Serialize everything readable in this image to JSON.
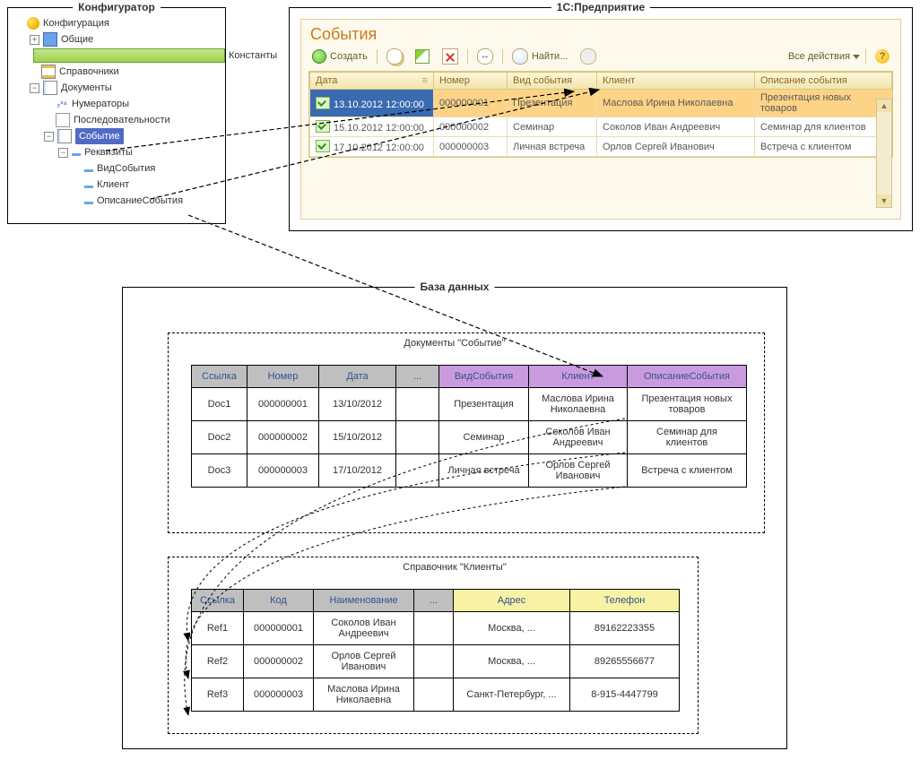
{
  "configurator": {
    "title": "Конфигуратор",
    "root": "Конфигурация",
    "items": {
      "common": "Общие",
      "constants": "Константы",
      "catalogs": "Справочники",
      "documents": "Документы",
      "numerators": "Нумераторы",
      "sequences": "Последовательности",
      "event": "Событие",
      "requisites": "Реквизиты",
      "req_kind": "ВидСобытия",
      "req_client": "Клиент",
      "req_desc": "ОписаниеСобытия"
    }
  },
  "enterprise": {
    "title": "1С:Предприятие",
    "heading": "События",
    "toolbar": {
      "create": "Создать",
      "find": "Найти...",
      "all_actions": "Все действия"
    },
    "columns": {
      "date": "Дата",
      "number": "Номер",
      "kind": "Вид события",
      "client": "Клиент",
      "desc": "Описание события"
    },
    "rows": [
      {
        "date": "13.10.2012 12:00:00",
        "number": "000000001",
        "kind": "Презентация",
        "client": "Маслова Ирина Николаевна",
        "desc": "Презентация новых товаров"
      },
      {
        "date": "15.10.2012 12:00:00",
        "number": "000000002",
        "kind": "Семинар",
        "client": "Соколов Иван Андреевич",
        "desc": "Семинар для клиентов"
      },
      {
        "date": "17.10.2012 12:00:00",
        "number": "000000003",
        "kind": "Личная встреча",
        "client": "Орлов Сергей Иванович",
        "desc": "Встреча с клиентом"
      }
    ]
  },
  "database": {
    "title": "База данных",
    "docs_caption": "Документы \"Событие\"",
    "clients_caption": "Справочник \"Клиенты\"",
    "docs": {
      "cols": {
        "ref": "Ссылка",
        "number": "Номер",
        "date": "Дата",
        "dots": "...",
        "kind": "ВидСобытия",
        "client": "Клиент",
        "desc": "ОписаниеСобытия"
      },
      "rows": [
        {
          "ref": "Doc1",
          "number": "000000001",
          "date": "13/10/2012",
          "kind": "Презентация",
          "client": "Маслова Ирина Николаевна",
          "desc": "Презентация новых товаров"
        },
        {
          "ref": "Doc2",
          "number": "000000002",
          "date": "15/10/2012",
          "kind": "Семинар",
          "client": "Соколов Иван Андреевич",
          "desc": "Семинар для клиентов"
        },
        {
          "ref": "Doc3",
          "number": "000000003",
          "date": "17/10/2012",
          "kind": "Личная встреча",
          "client": "Орлов Сергей Иванович",
          "desc": "Встреча с клиентом"
        }
      ]
    },
    "clients": {
      "cols": {
        "ref": "Ссылка",
        "code": "Код",
        "name": "Наименование",
        "dots": "...",
        "addr": "Адрес",
        "phone": "Телефон"
      },
      "rows": [
        {
          "ref": "Ref1",
          "code": "000000001",
          "name": "Соколов Иван Андреевич",
          "addr": "Москва, ...",
          "phone": "89162223355"
        },
        {
          "ref": "Ref2",
          "code": "000000002",
          "name": "Орлов Сергей Иванович",
          "addr": "Москва, ...",
          "phone": "89265556677"
        },
        {
          "ref": "Ref3",
          "code": "000000003",
          "name": "Маслова Ирина Николаевна",
          "addr": "Санкт-Петербург, ...",
          "phone": "8-915-4447799"
        }
      ]
    }
  }
}
